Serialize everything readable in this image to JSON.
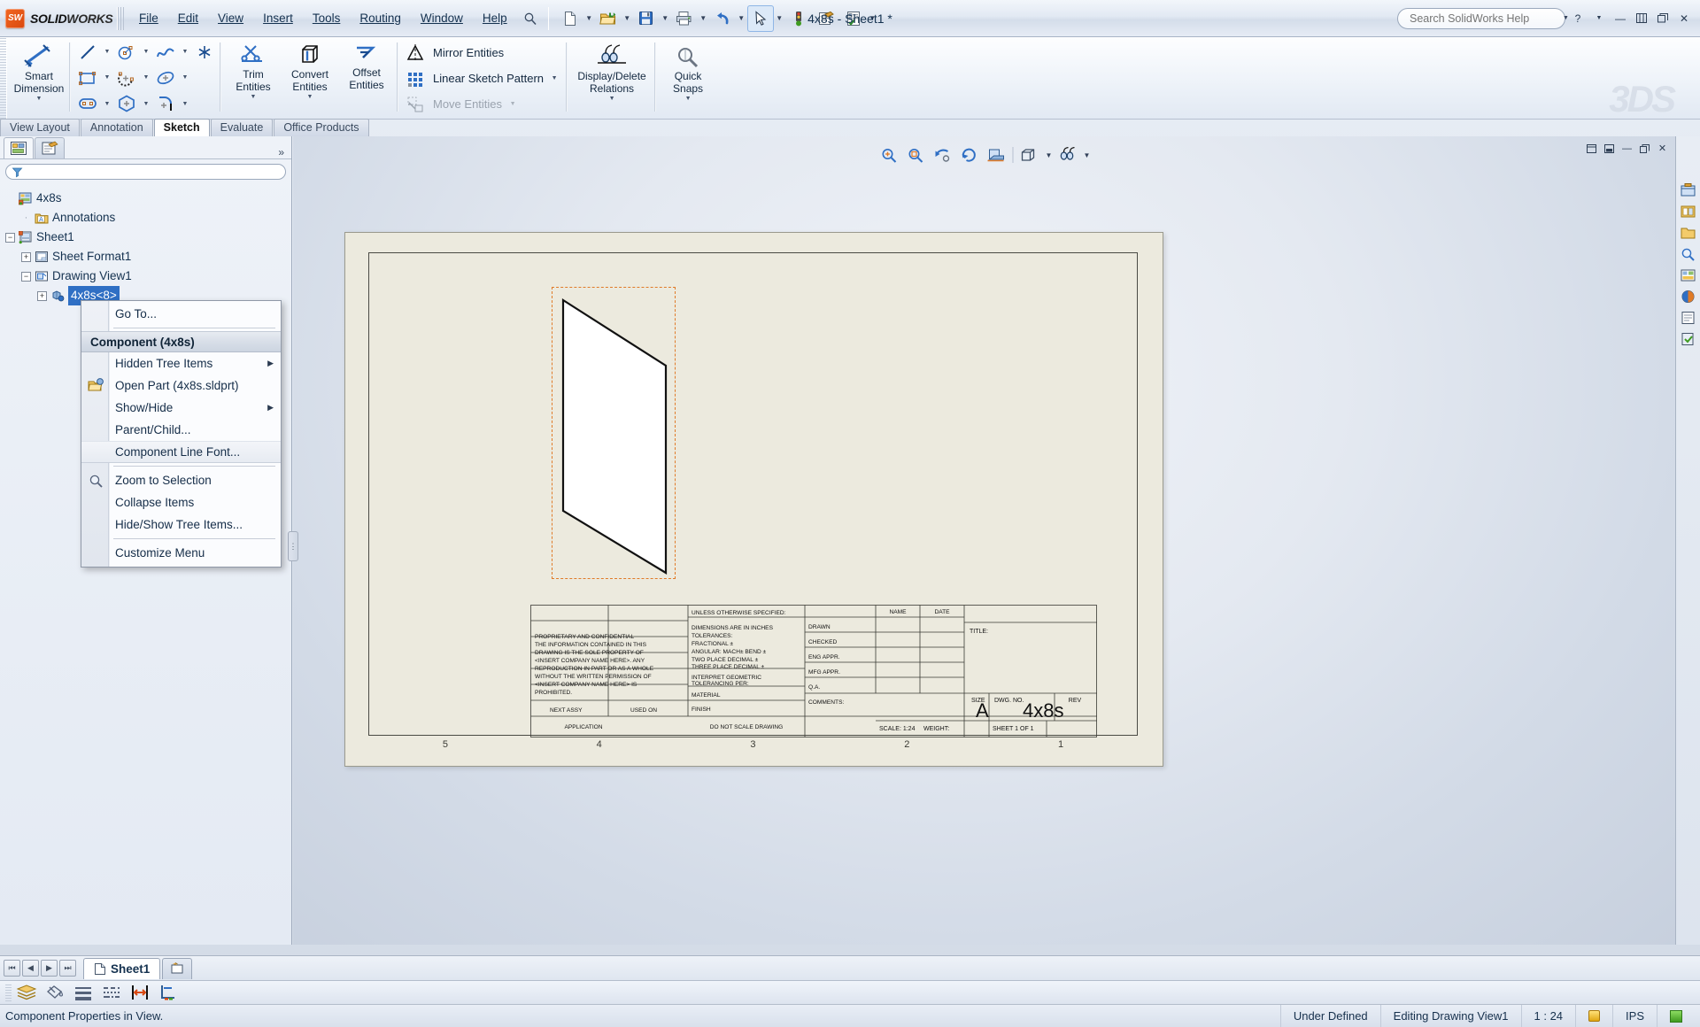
{
  "app": {
    "brand": "SOLIDWORKS",
    "brand_prefix": "SOLID",
    "brand_suffix": "WORKS",
    "document_title": "4x8s - Sheet1 *",
    "watermark": "3DS"
  },
  "menubar": {
    "items": [
      {
        "label": "File"
      },
      {
        "label": "Edit"
      },
      {
        "label": "View"
      },
      {
        "label": "Insert"
      },
      {
        "label": "Tools"
      },
      {
        "label": "Routing"
      },
      {
        "label": "Window"
      },
      {
        "label": "Help"
      }
    ]
  },
  "quick_access": {
    "buttons": [
      {
        "name": "new-document",
        "icon": "new-file-icon"
      },
      {
        "name": "open-document",
        "icon": "open-folder-icon"
      },
      {
        "name": "save-document",
        "icon": "save-disk-icon"
      },
      {
        "name": "print-document",
        "icon": "printer-icon"
      },
      {
        "name": "undo",
        "icon": "undo-arrow-icon"
      },
      {
        "name": "select",
        "icon": "cursor-arrow-icon"
      },
      {
        "name": "rebuild",
        "icon": "traffic-light-icon"
      },
      {
        "name": "options",
        "icon": "options-gear-icon"
      },
      {
        "name": "sheet-properties",
        "icon": "checklist-icon"
      }
    ]
  },
  "search": {
    "placeholder": "Search SolidWorks Help",
    "value": "",
    "icon": "help-question-icon",
    "magnifier": "search-icon"
  },
  "window_controls": {
    "help": "?",
    "minimize": "—",
    "restore": "❐",
    "close": "✕"
  },
  "ribbon": {
    "groups": [
      {
        "name": "smart-dimension",
        "big_buttons": [
          {
            "label_line1": "Smart",
            "label_line2": "Dimension",
            "icon": "smart-dimension-icon",
            "has_dropdown": true
          }
        ]
      },
      {
        "name": "sketch-entities",
        "small_rows": [
          [
            {
              "icon": "line-icon",
              "dropdown": true
            },
            {
              "icon": "circle-icon",
              "dropdown": true
            },
            {
              "icon": "spline-icon",
              "dropdown": true
            },
            {
              "icon": "point-icon",
              "dropdown": false
            }
          ],
          [
            {
              "icon": "rectangle-icon",
              "dropdown": true
            },
            {
              "icon": "arc-icon",
              "dropdown": true
            },
            {
              "icon": "ellipse-icon",
              "dropdown": true
            }
          ],
          [
            {
              "icon": "slot-icon",
              "dropdown": true
            },
            {
              "icon": "polygon-icon",
              "dropdown": true
            },
            {
              "icon": "fillet-icon",
              "dropdown": true
            }
          ]
        ]
      },
      {
        "name": "trim-convert-offset",
        "big_buttons": [
          {
            "label_line1": "Trim",
            "label_line2": "Entities",
            "icon": "trim-entities-icon",
            "has_dropdown": true
          },
          {
            "label_line1": "Convert",
            "label_line2": "Entities",
            "icon": "convert-entities-icon",
            "has_dropdown": true
          },
          {
            "label_line1": "Offset",
            "label_line2": "Entities",
            "icon": "offset-entities-icon",
            "has_dropdown": false
          }
        ]
      },
      {
        "name": "mirror-pattern-move",
        "text_rows": [
          {
            "label": "Mirror Entities",
            "icon": "mirror-entities-icon",
            "enabled": true,
            "dropdown": false
          },
          {
            "label": "Linear Sketch Pattern",
            "icon": "linear-sketch-pattern-icon",
            "enabled": true,
            "dropdown": true
          },
          {
            "label": "Move Entities",
            "icon": "move-entities-icon",
            "enabled": false,
            "dropdown": true
          }
        ]
      },
      {
        "name": "display-delete-relations",
        "big_buttons": [
          {
            "label_line1": "Display/Delete",
            "label_line2": "Relations",
            "icon": "display-delete-relations-icon",
            "has_dropdown": true
          }
        ]
      },
      {
        "name": "quick-snaps",
        "big_buttons": [
          {
            "label_line1": "Quick",
            "label_line2": "Snaps",
            "icon": "quick-snaps-icon",
            "has_dropdown": true
          }
        ]
      }
    ]
  },
  "command_tabs": {
    "items": [
      {
        "label": "View Layout",
        "active": false
      },
      {
        "label": "Annotation",
        "active": false
      },
      {
        "label": "Sketch",
        "active": true
      },
      {
        "label": "Evaluate",
        "active": false
      },
      {
        "label": "Office Products",
        "active": false
      }
    ]
  },
  "feature_manager": {
    "tabs": [
      {
        "name": "feature-manager-tab",
        "icon": "feature-tree-icon",
        "active": true
      },
      {
        "name": "property-manager-tab",
        "icon": "property-manager-icon",
        "active": false
      }
    ],
    "chevron": "»",
    "filter": {
      "placeholder": "",
      "value": "",
      "icon": "filter-funnel-icon"
    },
    "tree": [
      {
        "label": "4x8s",
        "depth": 0,
        "icon": "drawing-doc-icon",
        "expander": "none",
        "selected": false
      },
      {
        "label": "Annotations",
        "depth": 1,
        "icon": "annotations-folder-icon",
        "expander": "none",
        "selected": false
      },
      {
        "label": "Sheet1",
        "depth": 0,
        "icon": "sheet-icon",
        "expander": "minus",
        "selected": false
      },
      {
        "label": "Sheet Format1",
        "depth": 1,
        "icon": "sheet-format-icon",
        "expander": "plus",
        "selected": false
      },
      {
        "label": "Drawing View1",
        "depth": 1,
        "icon": "drawing-view-icon",
        "expander": "minus",
        "selected": false
      },
      {
        "label": "4x8s<8>",
        "depth": 2,
        "icon": "component-icon",
        "expander": "plus",
        "selected": true
      }
    ]
  },
  "context_menu": {
    "items": [
      {
        "type": "item",
        "label": "Go To...",
        "icon": null,
        "submenu": false
      },
      {
        "type": "separator"
      },
      {
        "type": "header",
        "label": "Component (4x8s)"
      },
      {
        "type": "item",
        "label": "Hidden Tree Items",
        "icon": null,
        "submenu": true
      },
      {
        "type": "item",
        "label": "Open Part (4x8s.sldprt)",
        "icon": "open-part-icon",
        "submenu": false
      },
      {
        "type": "item",
        "label": "Show/Hide",
        "icon": null,
        "submenu": true
      },
      {
        "type": "item",
        "label": "Parent/Child...",
        "icon": null,
        "submenu": false
      },
      {
        "type": "highlight-item",
        "label": "Component Line Font...",
        "icon": null,
        "submenu": false
      },
      {
        "type": "separator"
      },
      {
        "type": "item",
        "label": "Zoom to Selection",
        "icon": "zoom-selection-icon",
        "submenu": false
      },
      {
        "type": "item",
        "label": "Collapse Items",
        "icon": null,
        "submenu": false
      },
      {
        "type": "item",
        "label": "Hide/Show Tree Items...",
        "icon": null,
        "submenu": false
      },
      {
        "type": "separator"
      },
      {
        "type": "item",
        "label": "Customize Menu",
        "icon": null,
        "submenu": false
      }
    ]
  },
  "view_toolbar": {
    "buttons": [
      {
        "name": "zoom-to-fit-button",
        "icon": "zoom-fit-icon"
      },
      {
        "name": "zoom-to-area-button",
        "icon": "zoom-area-icon"
      },
      {
        "name": "previous-view-button",
        "icon": "previous-view-icon"
      },
      {
        "name": "rebuild-button",
        "icon": "rebuild-circular-icon"
      },
      {
        "name": "section-view-button",
        "icon": "section-view-icon"
      },
      {
        "name": "display-style-button",
        "icon": "display-style-icon"
      },
      {
        "name": "view-settings-button",
        "icon": "view-settings-icon"
      }
    ]
  },
  "drawing_sheet": {
    "zone_labels": [
      "5",
      "4",
      "3",
      "2",
      "1"
    ],
    "title_block": {
      "unless_specified": "UNLESS OTHERWISE SPECIFIED:",
      "dimensions_note": "DIMENSIONS ARE IN INCHES",
      "tolerances_label": "TOLERANCES:",
      "fractional": "FRACTIONAL ±",
      "angular": "ANGULAR: MACH±      BEND ±",
      "two_place": "TWO PLACE DECIMAL    ±",
      "three_place": "THREE PLACE DECIMAL  ±",
      "interpret_line1": "INTERPRET GEOMETRIC",
      "interpret_line2": "TOLERANCING PER:",
      "material": "MATERIAL",
      "finish": "FINISH",
      "next_assy": "NEXT ASSY",
      "used_on": "USED ON",
      "application": "APPLICATION",
      "do_not_scale": "DO NOT SCALE DRAWING",
      "name_col": "NAME",
      "date_col": "DATE",
      "rows": [
        "DRAWN",
        "CHECKED",
        "ENG APPR.",
        "MFG APPR.",
        "Q.A."
      ],
      "comments": "COMMENTS:",
      "title_label": "TITLE:",
      "title_value": "",
      "size_label": "SIZE",
      "size_value": "A",
      "dwgno_label": "DWG.  NO.",
      "dwgno_value": "4x8s",
      "rev_label": "REV",
      "rev_value": "",
      "scale": "SCALE: 1:24",
      "weight": "WEIGHT:",
      "sheet": "SHEET 1 OF 1"
    }
  },
  "sheet_tabs": {
    "nav": [
      "⏮",
      "◀",
      "▶",
      "⏭"
    ],
    "active_tab": "Sheet1",
    "add_sheet_name": "add-sheet-icon"
  },
  "bottom_toolbar": {
    "buttons": [
      {
        "name": "layer-properties-button",
        "icon": "layers-icon"
      },
      {
        "name": "line-color-button",
        "icon": "paint-can-icon"
      },
      {
        "name": "line-thickness-button",
        "icon": "line-thickness-icon"
      },
      {
        "name": "line-style-button",
        "icon": "line-style-icon"
      },
      {
        "name": "hide-edge-button",
        "icon": "hide-edge-icon"
      },
      {
        "name": "color-display-mode-button",
        "icon": "color-display-icon"
      }
    ]
  },
  "status_bar": {
    "message": "Component Properties in View.",
    "state": "Under Defined",
    "editing": "Editing Drawing View1",
    "scale": "1 : 24",
    "units": "IPS",
    "indicator_icon": "rebuild-indicator-icon",
    "expand_icon": "expand-status-icon"
  }
}
